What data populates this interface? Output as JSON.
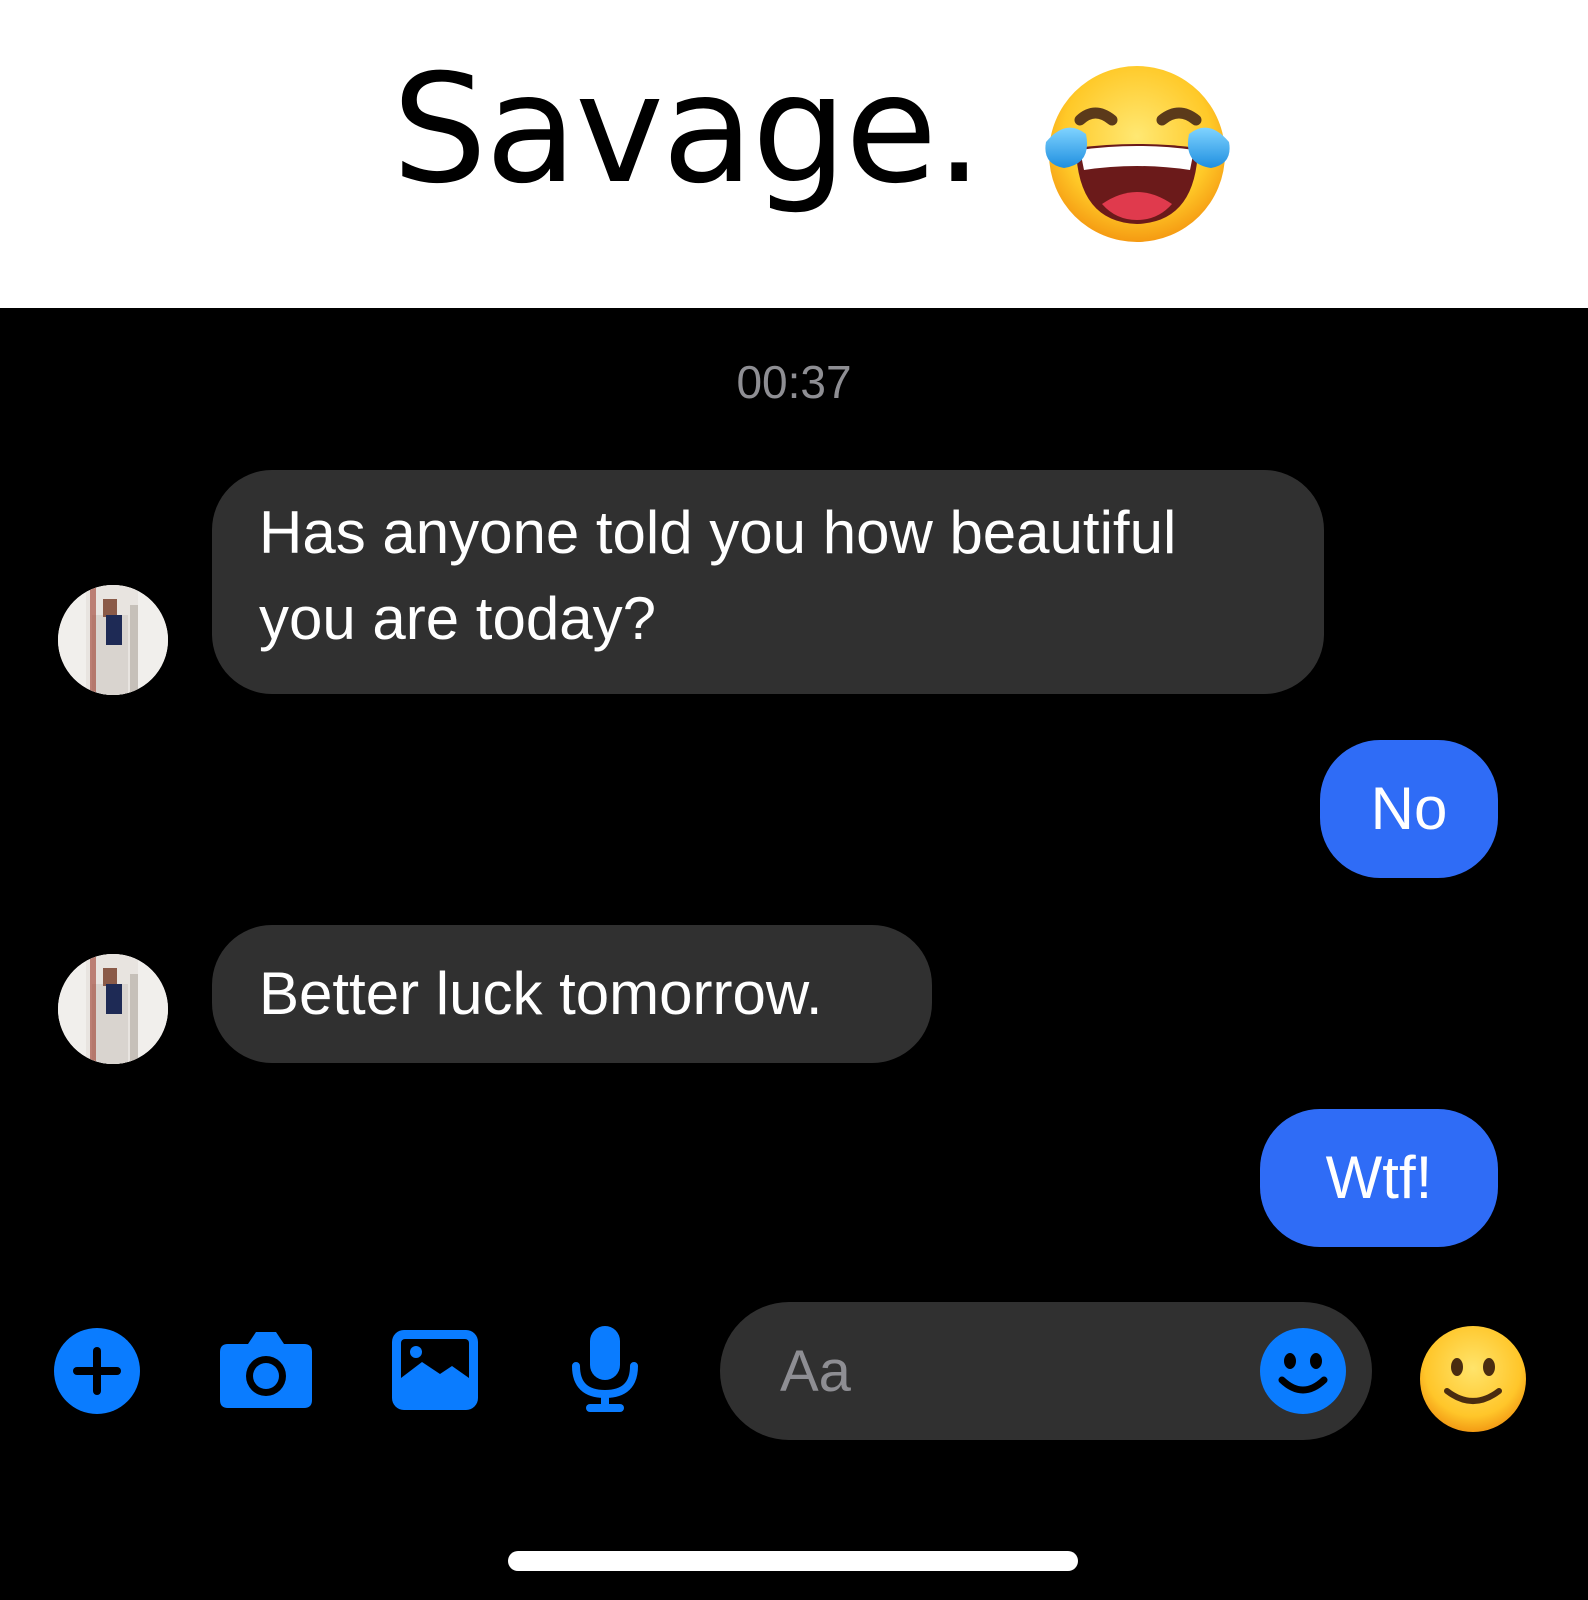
{
  "caption": {
    "title": "Savage.",
    "emoji": "face-with-tears-of-joy"
  },
  "chat": {
    "timestamp": "00:37",
    "messages": [
      {
        "direction": "incoming",
        "text_line1": "Has anyone told you how beautiful",
        "text_line2": "you are today?"
      },
      {
        "direction": "outgoing",
        "text": "No"
      },
      {
        "direction": "incoming",
        "text": "Better luck tomorrow."
      },
      {
        "direction": "outgoing",
        "text": "Wtf!"
      }
    ]
  },
  "composer": {
    "placeholder": "Aa",
    "icons": [
      "plus-icon",
      "camera-icon",
      "gallery-icon",
      "microphone-icon",
      "emoji-picker-icon",
      "smiley-like-icon"
    ]
  },
  "colors": {
    "accent": "#0a7cff",
    "outgoing_bubble": "#2f6cf6",
    "incoming_bubble": "#303030",
    "background": "#000000"
  }
}
